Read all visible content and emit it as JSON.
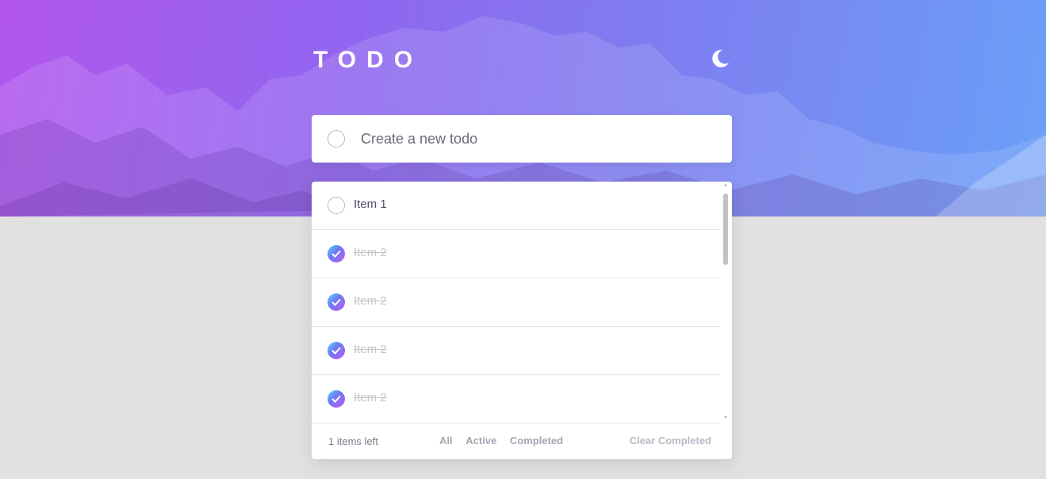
{
  "app": {
    "title": "TODO"
  },
  "header": {
    "theme_toggle_icon": "moon-icon"
  },
  "new_todo": {
    "placeholder": "Create a new todo",
    "value": ""
  },
  "todos": [
    {
      "label": "Item 1",
      "completed": false
    },
    {
      "label": "Item 2",
      "completed": true
    },
    {
      "label": "Item 2",
      "completed": true
    },
    {
      "label": "Item 2",
      "completed": true
    },
    {
      "label": "Item 2",
      "completed": true
    }
  ],
  "footer": {
    "items_left": "1 items left",
    "filters": [
      "All",
      "Active",
      "Completed"
    ],
    "clear_label": "Clear Completed"
  },
  "colors": {
    "hero_start": "#b256ee",
    "hero_end": "#6aa0f8",
    "check_gradient_start": "#55ddff",
    "check_gradient_end": "#c058f3",
    "page_background": "#e1e1e1"
  }
}
